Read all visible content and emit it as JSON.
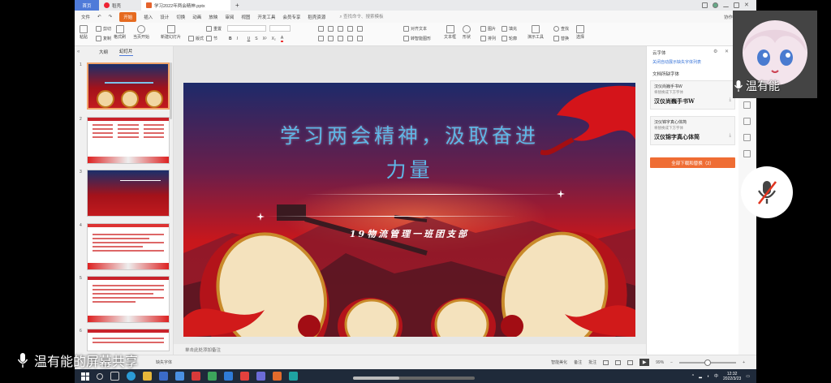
{
  "window": {
    "home_tab": "首页",
    "template_tab": "稻壳",
    "file_tab": "学习2022年两会精神.pptx",
    "new_tab": "+"
  },
  "menu": {
    "file": "文件",
    "items": [
      "开始",
      "插入",
      "设计",
      "切换",
      "动画",
      "放映",
      "审阅",
      "视图",
      "开发工具",
      "会员专享",
      "稻壳资源"
    ],
    "search": "查找命令、搜索模板",
    "right": [
      "协作",
      "分享"
    ]
  },
  "ribbon": {
    "paste": "粘贴",
    "cut": "剪切",
    "copy": "复制",
    "format_painter": "格式刷",
    "play_from_current": "当页开始",
    "new_slide": "新建幻灯片",
    "layout": "版式",
    "section": "节",
    "reset": "重置",
    "text_box": "文本框",
    "shape": "形状",
    "arrange": "排列",
    "picture": "图片",
    "fill": "填充",
    "outline": "轮廓",
    "presentation_tools": "演示工具",
    "find": "查找",
    "replace": "替换",
    "select": "选择",
    "smartart": "转智能图形",
    "align_text": "对齐文本"
  },
  "left_panel": {
    "tab_outline": "大纲",
    "tab_slides": "幻灯片",
    "slide_numbers": [
      "1",
      "2",
      "3",
      "4",
      "5",
      "6"
    ]
  },
  "slide": {
    "title_line1": "学习两会精神，汲取奋进",
    "title_line2": "力量",
    "subtitle": "19物流管理一班团支部"
  },
  "notes": {
    "placeholder": "单击此处添加备注"
  },
  "right_panel": {
    "header": "云字体",
    "link": "关闭自动展示缺失字体列表",
    "section": "文档所缺字体",
    "font1_name": "汉仪尚巍手书W",
    "font1_hint": "将替换成下方字体",
    "font1_sample": "汉仪尚巍手书W",
    "font2_name": "汉仪锦字真心体简",
    "font2_hint": "将替换成下方字体",
    "font2_sample": "汉仪锦字真心体简",
    "button": "全部下载和替换（2）"
  },
  "status": {
    "missing_font": "缺失字体",
    "smart_beautify": "智能美化",
    "notes": "备注",
    "comment": "批注",
    "zoom": "99%",
    "zoom_level": 0.5
  },
  "taskbar": {
    "time": "12:32",
    "date": "2022/3/23"
  },
  "overlay": {
    "participant_name": "温有能",
    "screen_share": "温有能的屏幕共享"
  },
  "colors": {
    "accent_orange": "#ef6d34",
    "title_blue": "#5fb6e6",
    "tab_blue": "#4f7bd9"
  }
}
